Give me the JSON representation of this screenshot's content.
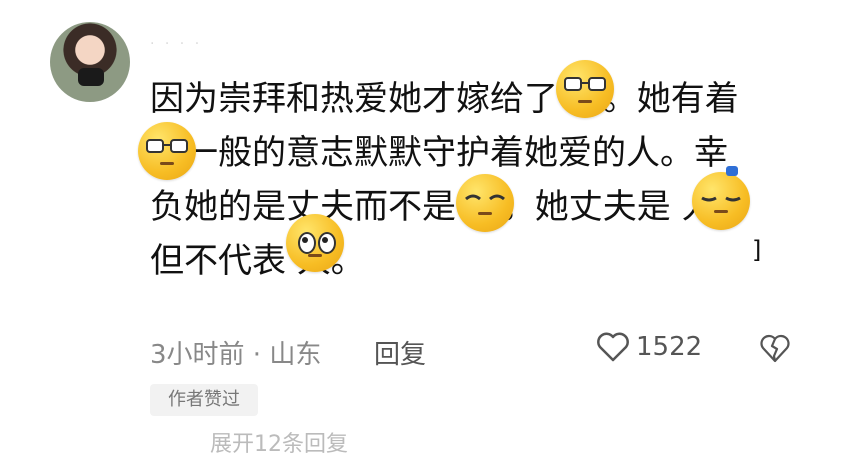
{
  "comment": {
    "username": "· · · ·",
    "lines": [
      "因为崇拜和热爱她才嫁给了      人。她有着",
      "       人一般的意志默默守护着她爱的人。幸",
      "负她的是丈夫而不是      人。她丈夫是      人",
      "但不代表      人。"
    ],
    "trailing_mark": "]"
  },
  "footer": {
    "meta": "3小时前 · 山东",
    "reply_label": "回复",
    "like_count": "1522",
    "author_tag": "作者赞过",
    "more_replies_partial": "展开12条回复"
  },
  "icons": {
    "like": "heart-icon",
    "dislike": "broken-heart-icon"
  }
}
